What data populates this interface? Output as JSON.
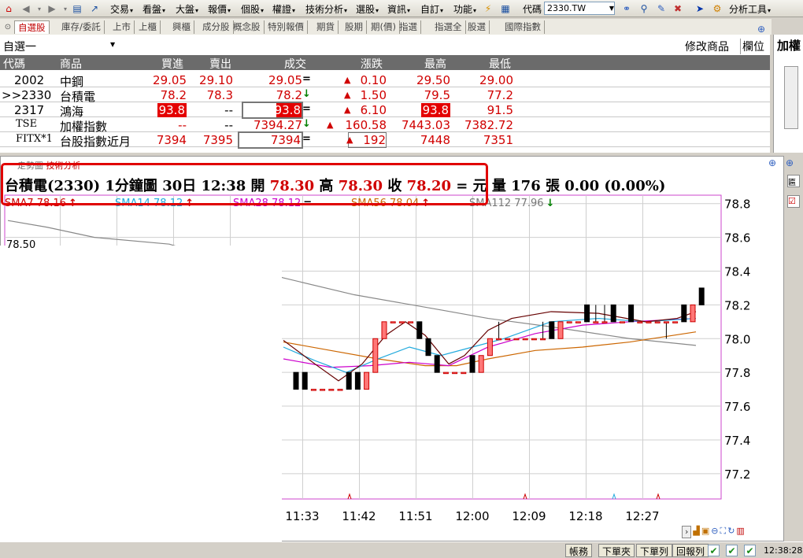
{
  "menubar": {
    "items": [
      "交易",
      "看盤",
      "大盤",
      "報價",
      "個股",
      "權證",
      "技術分析",
      "選股",
      "資訊",
      "自訂",
      "功能"
    ],
    "code_label": "代碼",
    "code_value": "2330.TW",
    "analysis_tools": "分析工具"
  },
  "tabs": [
    "自選股",
    "庫存/委託",
    "上市",
    "上櫃",
    "興櫃",
    "成分股",
    "概念股",
    "特別報價",
    "期貨",
    "股期",
    "期(價)",
    "指選",
    "指選全",
    "股選",
    "國際指數"
  ],
  "quote": {
    "group": "自選一",
    "modify": "修改商品",
    "columns_btn": "欄位",
    "side_label": "加權",
    "headers": [
      "代碼",
      "商品",
      "買進",
      "賣出",
      "成交",
      "漲跌",
      "最高",
      "最低"
    ],
    "rows": [
      {
        "code": "2002",
        "name": "中鋼",
        "bid": "29.05",
        "ask": "29.10",
        "last": "29.05",
        "flag": "=",
        "chg": "0.10",
        "high": "29.50",
        "low": "29.00"
      },
      {
        "code": ">>2330",
        "name": "台積電",
        "bid": "78.2",
        "ask": "78.3",
        "last": "78.2",
        "flag": "↓",
        "chg": "1.50",
        "high": "79.5",
        "low": "77.2"
      },
      {
        "code": "2317",
        "name": "鴻海",
        "bid": "93.8",
        "ask": "--",
        "last": "93.8",
        "flag": "=",
        "chg": "6.10",
        "high": "93.8",
        "low": "91.5"
      },
      {
        "code": "TSE",
        "name": "加權指數",
        "bid": "--",
        "ask": "--",
        "last": "7394.27",
        "flag": "↓",
        "chg": "160.58",
        "high": "7443.03",
        "low": "7382.72"
      },
      {
        "code": "FITX*1",
        "name": "台股指數近月",
        "bid": "7394",
        "ask": "7395",
        "last": "7394",
        "flag": "=",
        "chg": "192",
        "high": "7448",
        "low": "7351"
      }
    ]
  },
  "chart": {
    "tabs": [
      "走勢圖",
      "技術分析"
    ],
    "title_prefix": "台積電(2330)  1分鐘圖  30日 12:38  開 ",
    "open": "78.30",
    "high_label": "  高 ",
    "high": "78.30",
    "close_label": "  收 ",
    "close": "78.20",
    "tail": " = 元  量 176 張  0.00 (0.00%)",
    "ma": [
      {
        "label": "SMA7 78.16",
        "color": "#cc0000",
        "arrow": "↑"
      },
      {
        "label": "SMA14 78.12",
        "color": "#22aadd",
        "arrow": "↑"
      },
      {
        "label": "SMA28 78.12",
        "color": "#cc00cc",
        "arrow": "="
      },
      {
        "label": "SMA56 78.04",
        "color": "#cc6600",
        "arrow": "↑"
      },
      {
        "label": "SMA112 77.96",
        "color": "#777777",
        "arrow": "↓"
      }
    ],
    "left_price": "78.50"
  },
  "chart_data": {
    "type": "candlestick",
    "title": "台積電(2330) 1分鐘圖",
    "ylim": [
      77.05,
      78.85
    ],
    "yticks": [
      78.8,
      78.6,
      78.4,
      78.2,
      78.0,
      77.8,
      77.6,
      77.4,
      77.2
    ],
    "xticks": [
      "11:33",
      "11:42",
      "11:51",
      "12:00",
      "12:09",
      "12:18",
      "12:27"
    ],
    "series": [
      {
        "name": "SMA7",
        "color": "#cc0000"
      },
      {
        "name": "SMA14",
        "color": "#22aadd"
      },
      {
        "name": "SMA28",
        "color": "#cc00cc"
      },
      {
        "name": "SMA56",
        "color": "#cc6600"
      },
      {
        "name": "SMA112",
        "color": "#777777"
      }
    ],
    "candles": [
      {
        "x": 0,
        "o": 77.8,
        "c": 77.7,
        "h": 77.8,
        "l": 77.7
      },
      {
        "x": 1,
        "o": 77.8,
        "c": 77.7,
        "h": 77.8,
        "l": 77.7
      },
      {
        "x": 2,
        "o": 77.7,
        "c": 77.7,
        "h": 77.7,
        "l": 77.7
      },
      {
        "x": 3,
        "o": 77.7,
        "c": 77.7,
        "h": 77.7,
        "l": 77.7
      },
      {
        "x": 4,
        "o": 77.7,
        "c": 77.7,
        "h": 77.7,
        "l": 77.7
      },
      {
        "x": 5,
        "o": 77.7,
        "c": 77.7,
        "h": 77.7,
        "l": 77.7
      },
      {
        "x": 6,
        "o": 77.8,
        "c": 77.7,
        "h": 77.8,
        "l": 77.7
      },
      {
        "x": 7,
        "o": 77.8,
        "c": 77.7,
        "h": 77.8,
        "l": 77.7
      },
      {
        "x": 8,
        "o": 77.7,
        "c": 77.8,
        "h": 77.8,
        "l": 77.7
      },
      {
        "x": 9,
        "o": 77.8,
        "c": 78.0,
        "h": 78.0,
        "l": 77.8
      },
      {
        "x": 10,
        "o": 78.0,
        "c": 78.1,
        "h": 78.1,
        "l": 78.0
      },
      {
        "x": 11,
        "o": 78.1,
        "c": 78.1,
        "h": 78.1,
        "l": 78.1
      },
      {
        "x": 12,
        "o": 78.1,
        "c": 78.1,
        "h": 78.1,
        "l": 78.1
      },
      {
        "x": 13,
        "o": 78.1,
        "c": 78.1,
        "h": 78.1,
        "l": 78.1
      },
      {
        "x": 14,
        "o": 78.1,
        "c": 78.0,
        "h": 78.1,
        "l": 78.0
      },
      {
        "x": 15,
        "o": 78.0,
        "c": 77.9,
        "h": 78.0,
        "l": 77.9
      },
      {
        "x": 16,
        "o": 77.9,
        "c": 77.8,
        "h": 77.9,
        "l": 77.8
      },
      {
        "x": 17,
        "o": 77.8,
        "c": 77.8,
        "h": 77.8,
        "l": 77.8
      },
      {
        "x": 18,
        "o": 77.8,
        "c": 77.8,
        "h": 77.8,
        "l": 77.8
      },
      {
        "x": 19,
        "o": 77.8,
        "c": 77.8,
        "h": 77.8,
        "l": 77.8
      },
      {
        "x": 20,
        "o": 77.9,
        "c": 77.8,
        "h": 77.9,
        "l": 77.8
      },
      {
        "x": 21,
        "o": 77.8,
        "c": 77.9,
        "h": 77.9,
        "l": 77.8
      },
      {
        "x": 22,
        "o": 77.9,
        "c": 78.0,
        "h": 78.0,
        "l": 77.9
      },
      {
        "x": 23,
        "o": 78.0,
        "c": 78.0,
        "h": 78.1,
        "l": 78.0
      },
      {
        "x": 24,
        "o": 78.0,
        "c": 78.0,
        "h": 78.0,
        "l": 78.0
      },
      {
        "x": 25,
        "o": 78.0,
        "c": 78.0,
        "h": 78.0,
        "l": 78.0
      },
      {
        "x": 26,
        "o": 78.0,
        "c": 78.0,
        "h": 78.0,
        "l": 78.0
      },
      {
        "x": 27,
        "o": 78.0,
        "c": 78.0,
        "h": 78.0,
        "l": 78.0
      },
      {
        "x": 28,
        "o": 78.0,
        "c": 78.0,
        "h": 78.1,
        "l": 78.0
      },
      {
        "x": 29,
        "o": 78.1,
        "c": 78.0,
        "h": 78.1,
        "l": 78.0
      },
      {
        "x": 30,
        "o": 78.0,
        "c": 78.1,
        "h": 78.1,
        "l": 78.0
      },
      {
        "x": 31,
        "o": 78.1,
        "c": 78.1,
        "h": 78.1,
        "l": 78.1
      },
      {
        "x": 32,
        "o": 78.1,
        "c": 78.1,
        "h": 78.1,
        "l": 78.1
      },
      {
        "x": 33,
        "o": 78.2,
        "c": 78.1,
        "h": 78.2,
        "l": 78.1
      },
      {
        "x": 34,
        "o": 78.1,
        "c": 78.1,
        "h": 78.2,
        "l": 78.1
      },
      {
        "x": 35,
        "o": 78.1,
        "c": 78.1,
        "h": 78.2,
        "l": 78.1
      },
      {
        "x": 36,
        "o": 78.2,
        "c": 78.1,
        "h": 78.2,
        "l": 78.1
      },
      {
        "x": 37,
        "o": 78.1,
        "c": 78.1,
        "h": 78.1,
        "l": 78.1
      },
      {
        "x": 38,
        "o": 78.2,
        "c": 78.1,
        "h": 78.2,
        "l": 78.1
      },
      {
        "x": 39,
        "o": 78.1,
        "c": 78.1,
        "h": 78.1,
        "l": 78.1
      },
      {
        "x": 40,
        "o": 78.1,
        "c": 78.1,
        "h": 78.1,
        "l": 78.1
      },
      {
        "x": 41,
        "o": 78.1,
        "c": 78.1,
        "h": 78.1,
        "l": 78.1
      },
      {
        "x": 42,
        "o": 78.1,
        "c": 78.1,
        "h": 78.1,
        "l": 78.0
      },
      {
        "x": 43,
        "o": 78.1,
        "c": 78.1,
        "h": 78.1,
        "l": 78.1
      },
      {
        "x": 44,
        "o": 78.2,
        "c": 78.1,
        "h": 78.2,
        "l": 78.1
      },
      {
        "x": 45,
        "o": 78.1,
        "c": 78.2,
        "h": 78.2,
        "l": 78.1
      },
      {
        "x": 46,
        "o": 78.3,
        "c": 78.2,
        "h": 78.3,
        "l": 78.2
      }
    ]
  },
  "status": {
    "buttons": [
      "帳務",
      "下單夾",
      "下單列",
      "回報列"
    ],
    "time": "12:38:28"
  }
}
